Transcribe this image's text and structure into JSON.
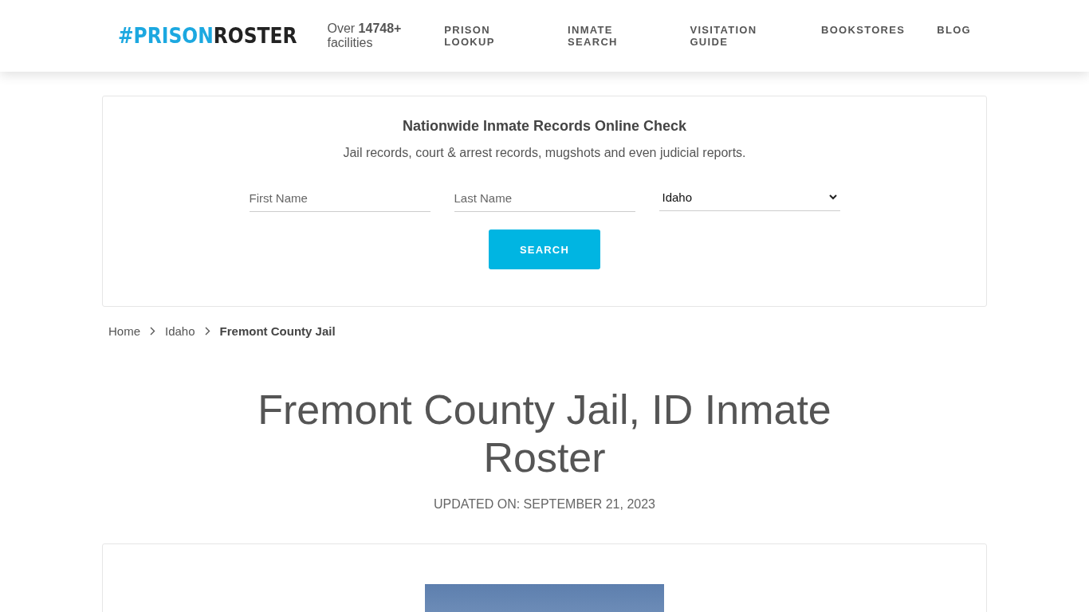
{
  "header": {
    "logo": {
      "hash_part": "#PRISON",
      "rest_part": "ROSTER"
    },
    "facilities": "Over **14748+** facilities",
    "nav": [
      {
        "label": "PRISON LOOKUP"
      },
      {
        "label": "INMATE SEARCH"
      },
      {
        "label": "VISITATION GUIDE"
      },
      {
        "label": "BOOKSTORES"
      },
      {
        "label": "BLOG"
      }
    ]
  },
  "search_card": {
    "title": "Nationwide Inmate Records Online Check",
    "subtitle": "Jail records, court & arrest records, mugshots and even judicial reports.",
    "first_name": {
      "placeholder": "First Name"
    },
    "last_name": {
      "placeholder": "Last Name"
    },
    "state": {
      "value": "Idaho"
    },
    "button": "SEARCH"
  },
  "breadcrumb": [
    {
      "label": "Home",
      "current": false
    },
    {
      "label": "Idaho",
      "current": false
    },
    {
      "label": "Fremont County Jail",
      "current": true
    }
  ],
  "page": {
    "title": "Fremont County Jail, ID Inmate Roster",
    "updated": "UPDATED ON: SEPTEMBER 21, 2023"
  }
}
